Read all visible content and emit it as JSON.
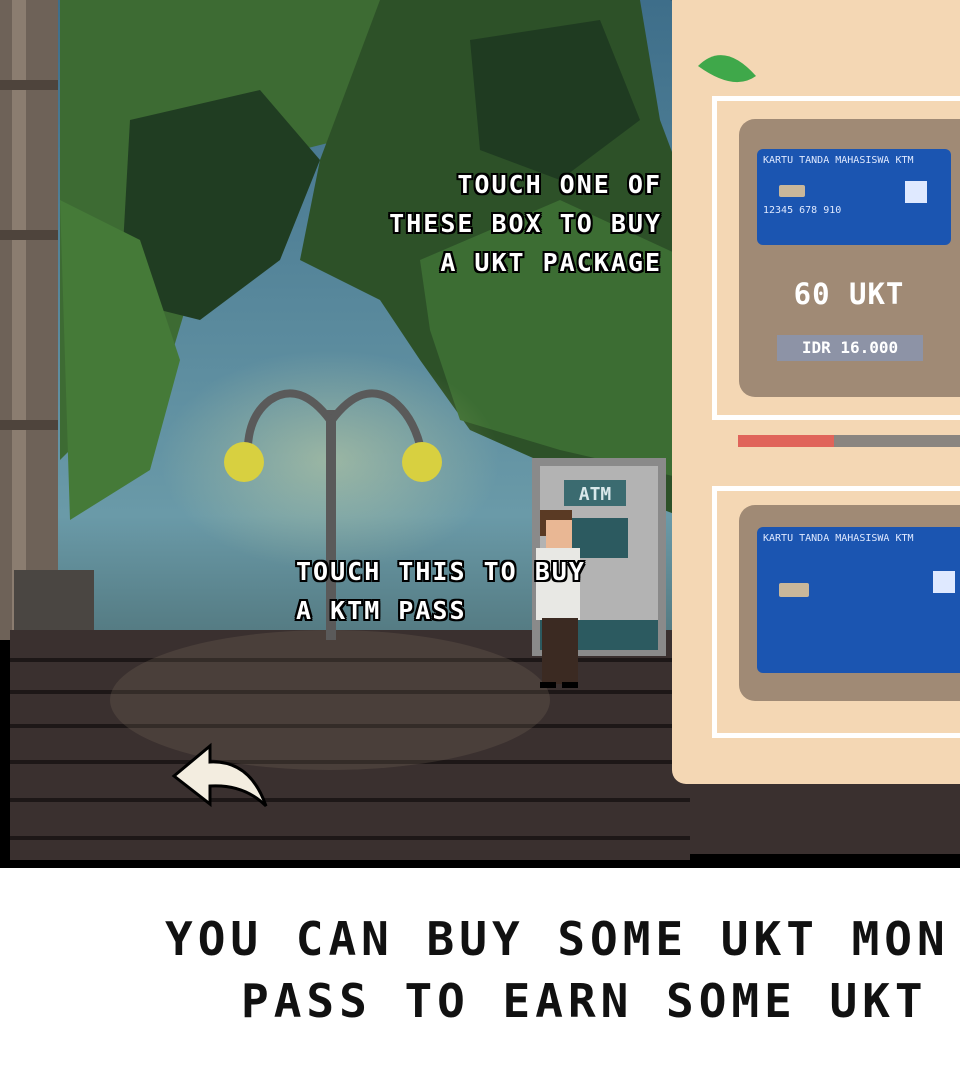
{
  "scene": {
    "hint_top": [
      "Touch one of",
      "these box to buy",
      "a UKT package"
    ],
    "hint_bottom": [
      "touch this to buy",
      "a KTM pass"
    ],
    "atm_sign": "ATM",
    "back_icon": "back-arrow-icon"
  },
  "shop": {
    "ukt_package": {
      "card_header": "KARTU TANDA MAHASISWA  KTM",
      "card_number": "12345 678 910",
      "amount": "60 UKT",
      "price": "IDR 16.000"
    },
    "ktm_pass": {
      "card_header": "KARTU TANDA MAHASISWA  KTM"
    },
    "progress_fraction": 0.4
  },
  "caption": {
    "line1": "You can buy some UKT mon",
    "line2": "pass to earn some UKT"
  },
  "colors": {
    "panel": "#f4d7b4",
    "card": "#1b55b1",
    "progress": "#e0645a"
  }
}
